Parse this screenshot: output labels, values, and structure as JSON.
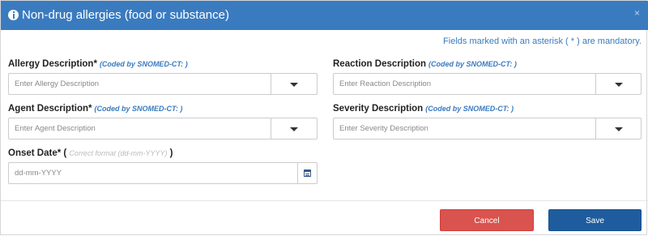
{
  "modal": {
    "title": "Non-drug allergies (food or substance)",
    "close_label": "×",
    "mandatory_note": "Fields marked with an asterisk ( * ) are mandatory.",
    "coded_by": "(Coded by SNOMED-CT: )"
  },
  "fields": {
    "allergy": {
      "label": "Allergy Description",
      "required": "*",
      "placeholder": "Enter Allergy Description"
    },
    "reaction": {
      "label": "Reaction Description",
      "placeholder": "Enter Reaction Description"
    },
    "agent": {
      "label": "Agent Description",
      "required": "*",
      "placeholder": "Enter Agent Description"
    },
    "severity": {
      "label": "Severity Description",
      "placeholder": "Enter Severity Description"
    },
    "onset": {
      "label": "Onset Date",
      "required": "*",
      "paren_open": " (",
      "format_hint": "Correct format (dd-mm-YYYY)",
      "paren_close": " )",
      "placeholder": "dd-mm-YYYY"
    }
  },
  "footer": {
    "cancel_label": "Cancel",
    "save_label": "Save"
  },
  "colors": {
    "header": "#3a7bc0",
    "cancel": "#d9534f",
    "save": "#1f5c9e"
  },
  "icons": [
    "info-icon",
    "close-icon",
    "caret-down-icon",
    "calendar-icon"
  ]
}
